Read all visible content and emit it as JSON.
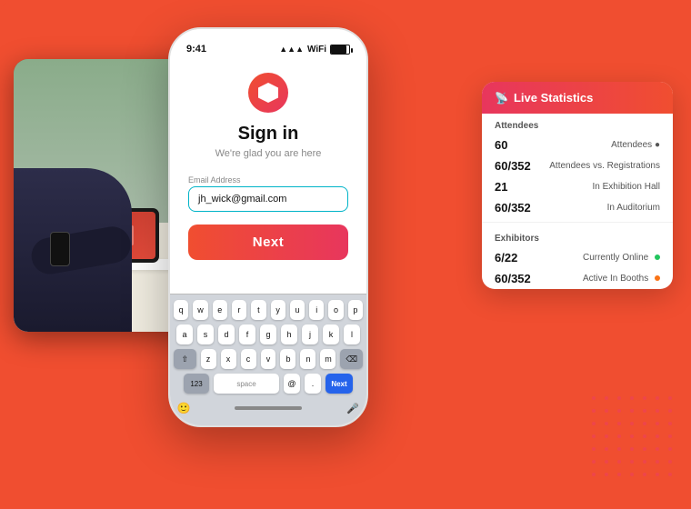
{
  "app": {
    "time": "9:41",
    "title": "Sign in",
    "subtitle": "We're glad you are here"
  },
  "form": {
    "email_label": "Email Address",
    "email_value": "jh_wick@gmail.com",
    "next_button": "Next"
  },
  "keyboard": {
    "row1": [
      "q",
      "w",
      "e",
      "r",
      "t",
      "y",
      "u",
      "i",
      "o",
      "p"
    ],
    "row2": [
      "a",
      "s",
      "d",
      "f",
      "g",
      "h",
      "j",
      "k",
      "l"
    ],
    "row3": [
      "z",
      "x",
      "c",
      "v",
      "b",
      "n",
      "m"
    ],
    "bottom_left": "123",
    "space": "space",
    "at": "@",
    "next": "Next",
    "period": "."
  },
  "stats": {
    "header": "Live Statistics",
    "sections": [
      {
        "label": "Attendees",
        "rows": [
          {
            "number": "60",
            "label": "Attendees"
          },
          {
            "number": "60/352",
            "label": "Attendees vs. Registrations"
          },
          {
            "number": "21",
            "label": "In Exhibition Hall"
          },
          {
            "number": "60/352",
            "label": "In Auditorium"
          }
        ]
      },
      {
        "label": "Exhibitors",
        "rows": [
          {
            "number": "6/22",
            "label": "Currently Online",
            "dot": "green"
          },
          {
            "number": "60/352",
            "label": "Active In Booths",
            "dot": "orange"
          }
        ]
      }
    ]
  },
  "icons": {
    "live": "📡",
    "logo_shape": "hexagon",
    "wifi": "▲",
    "battery": "battery"
  },
  "colors": {
    "primary_orange": "#f04e30",
    "primary_pink": "#e8365d",
    "accent_teal": "#00b4c8",
    "blue_key": "#2563eb"
  }
}
